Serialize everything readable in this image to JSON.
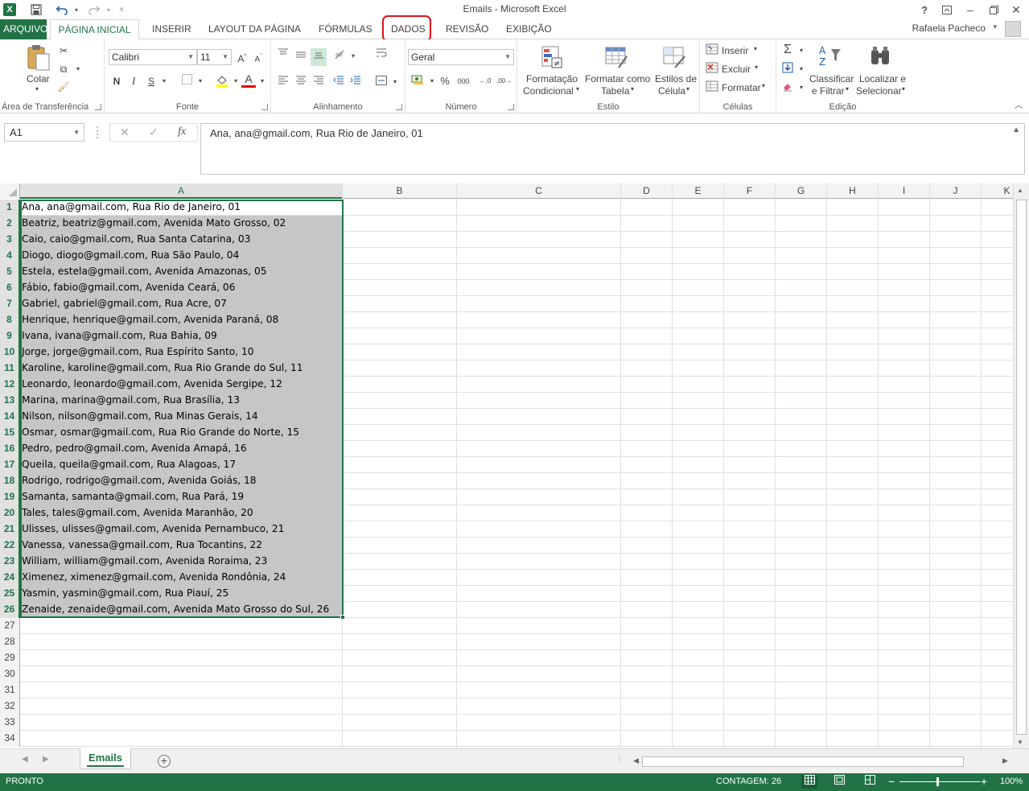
{
  "window": {
    "title": "Emails - Microsoft Excel",
    "user": "Rafaela Pacheco"
  },
  "tabs": {
    "file": "ARQUIVO",
    "items": [
      "PÁGINA INICIAL",
      "INSERIR",
      "LAYOUT DA PÁGINA",
      "FÓRMULAS",
      "DADOS",
      "REVISÃO",
      "EXIBIÇÃO"
    ],
    "active": "PÁGINA INICIAL",
    "highlighted": "DADOS",
    "highlight_color": "#e0141b"
  },
  "ribbon": {
    "clipboard": {
      "paste": "Colar",
      "label": "Área de Transferência"
    },
    "font": {
      "name": "Calibri",
      "size": "11",
      "bold": "N",
      "italic": "I",
      "underline": "S",
      "label": "Fonte"
    },
    "alignment": {
      "label": "Alinhamento"
    },
    "number": {
      "format": "Geral",
      "label": "Número",
      "percent": "%",
      "thousands": "000"
    },
    "styles": {
      "cond1": "Formatação",
      "cond2": "Condicional",
      "table1": "Formatar como",
      "table2": "Tabela",
      "cell1": "Estilos de",
      "cell2": "Célula",
      "label": "Estilo"
    },
    "cells": {
      "insert": "Inserir",
      "delete": "Excluir",
      "format": "Formatar",
      "label": "Células"
    },
    "editing": {
      "sort1": "Classificar",
      "sort2": "e Filtrar",
      "find1": "Localizar e",
      "find2": "Selecionar",
      "label": "Edição"
    }
  },
  "formula_bar": {
    "name_box": "A1",
    "fx": "fx",
    "content": "Ana, ana@gmail.com, Rua Rio de Janeiro, 01"
  },
  "grid": {
    "columns": [
      "A",
      "B",
      "C",
      "D",
      "E",
      "F",
      "G",
      "H",
      "I",
      "J",
      "K"
    ],
    "selected_column": "A",
    "rows": [
      "Ana, ana@gmail.com, Rua Rio de Janeiro, 01",
      "Beatriz, beatriz@gmail.com, Avenida Mato Grosso, 02",
      "Caio, caio@gmail.com, Rua Santa Catarina, 03",
      "Diogo, diogo@gmail.com, Rua São Paulo, 04",
      "Estela, estela@gmail.com, Avenida Amazonas, 05",
      "Fábio, fabio@gmail.com, Avenida Ceará, 06",
      "Gabriel, gabriel@gmail.com, Rua Acre, 07",
      "Henrique, henrique@gmail.com, Avenida Paraná, 08",
      "Ivana, ivana@gmail.com, Rua Bahia, 09",
      "Jorge, jorge@gmail.com, Rua Espírito Santo, 10",
      "Karoline, karoline@gmail.com, Rua Rio Grande do Sul, 11",
      "Leonardo, leonardo@gmail.com, Avenida Sergipe, 12",
      "Marina, marina@gmail.com, Rua Brasília, 13",
      "Nilson, nilson@gmail.com, Rua Minas Gerais, 14",
      "Osmar, osmar@gmail.com, Rua Rio Grande do Norte, 15",
      "Pedro, pedro@gmail.com, Avenida Amapá, 16",
      "Queila, queila@gmail.com, Rua Alagoas, 17",
      "Rodrigo, rodrigo@gmail.com, Avenida Goiás, 18",
      "Samanta, samanta@gmail.com, Rua Pará, 19",
      "Tales, tales@gmail.com, Avenida Maranhão, 20",
      "Ulisses, ulisses@gmail.com, Avenida Pernambuco, 21",
      "Vanessa, vanessa@gmail.com, Rua Tocantins, 22",
      "William, william@gmail.com, Avenida Roraima, 23",
      "Ximenez, ximenez@gmail.com, Avenida Rondônia, 24",
      "Yasmin, yasmin@gmail.com, Rua Piauí, 25",
      "Zenaide, zenaide@gmail.com, Avenida Mato Grosso do Sul, 26",
      "",
      "",
      "",
      "",
      "",
      "",
      "",
      ""
    ],
    "selected_rows": 26
  },
  "sheets": {
    "active": "Emails",
    "add": "+"
  },
  "status": {
    "ready": "PRONTO",
    "count": "CONTAGEM: 26",
    "zoom": "100%",
    "zoom_minus": "−",
    "zoom_plus": "+"
  },
  "colors": {
    "accent": "#217346",
    "selection_fill": "#c6c6c6"
  }
}
